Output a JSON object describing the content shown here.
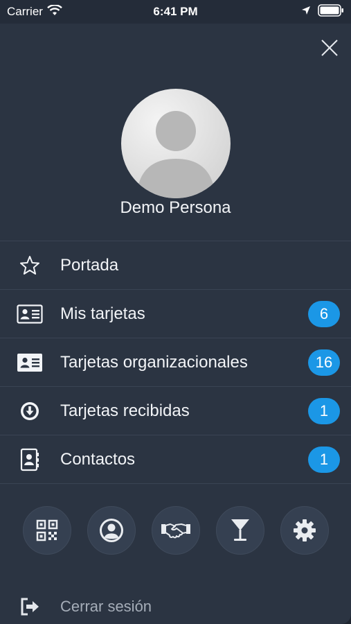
{
  "status_bar": {
    "carrier": "Carrier",
    "time": "6:41 PM"
  },
  "profile": {
    "name": "Demo Persona"
  },
  "menu": [
    {
      "label": "Portada",
      "icon": "star-icon",
      "badge": ""
    },
    {
      "label": "Mis tarjetas",
      "icon": "id-card-icon",
      "badge": "6"
    },
    {
      "label": "Tarjetas organizacionales",
      "icon": "id-card-filled-icon",
      "badge": "16"
    },
    {
      "label": "Tarjetas recibidas",
      "icon": "download-circle-icon",
      "badge": "1"
    },
    {
      "label": "Contactos",
      "icon": "contacts-book-icon",
      "badge": "1"
    }
  ],
  "shortcuts": [
    {
      "icon": "qr-code-icon"
    },
    {
      "icon": "user-circle-icon"
    },
    {
      "icon": "handshake-icon"
    },
    {
      "icon": "cocktail-icon"
    },
    {
      "icon": "gear-icon"
    }
  ],
  "logout": {
    "label": "Cerrar sesión",
    "icon": "sign-out-icon"
  },
  "colors": {
    "background": "#1e2530",
    "panel": "#2b3442",
    "badge": "#1b97e6",
    "text": "#f2f4f7",
    "muted_text": "#a5adb8"
  }
}
